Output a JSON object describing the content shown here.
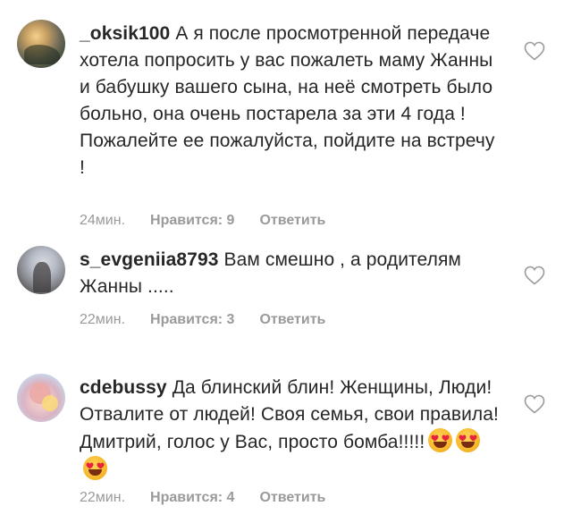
{
  "comments": [
    {
      "username": "_oksik100",
      "text": "А я после просмотренной передаче хотела попросить у вас пожалеть маму Жанны и бабушку вашего сына, на неё смотреть было больно, она очень постарела за эти 4 года ! Пожалейте ее пожалуйста, пойдите на встречу !",
      "time": "24мин.",
      "likes": "Нравится: 9",
      "reply": "Ответить"
    },
    {
      "username": "s_evgeniia8793",
      "text": "Вам смешно , а родителям Жанны .....",
      "time": "22мин.",
      "likes": "Нравится: 3",
      "reply": "Ответить"
    },
    {
      "username": "cdebussy",
      "text": "Да блинский блин! Женщины, Люди! Отвалите от людей! Своя семья, свои правила! Дмитрий, голос у Вас, просто бомба!!!!!",
      "emojis": [
        "heart-eyes-emoji",
        "heart-eyes-emoji",
        "heart-eyes-emoji"
      ],
      "time": "22мин.",
      "likes": "Нравится: 4",
      "reply": "Ответить"
    }
  ],
  "icons": {
    "like": "heart-outline-icon"
  },
  "colors": {
    "text": "#262626",
    "meta": "#9a9a9a",
    "emoji_face": "#f7b92c",
    "emoji_heart": "#e8233f"
  }
}
